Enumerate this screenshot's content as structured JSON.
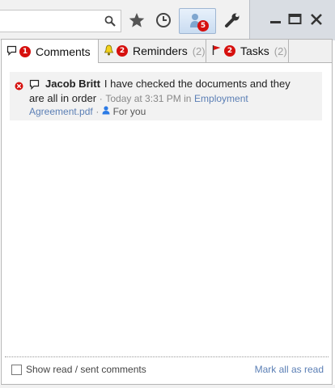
{
  "toolbar": {
    "extension_badge": "5"
  },
  "tabs": [
    {
      "label": "Comments",
      "badge": "1",
      "paren": ""
    },
    {
      "label": "Reminders",
      "badge": "2",
      "paren": "(2)"
    },
    {
      "label": "Tasks",
      "badge": "2",
      "paren": "(2)"
    }
  ],
  "comment": {
    "author": "Jacob Britt",
    "text_line1": "I have checked the documents and they",
    "text_line2": "are all in order",
    "separator": "·",
    "time": "Today at 3:31 PM in",
    "file_line1": "Employment",
    "file_line2": "Agreement.pdf",
    "for_you": "For you"
  },
  "footer": {
    "show_read_label": "Show read / sent comments",
    "mark_all_label": "Mark all as read"
  },
  "colors": {
    "badge_red": "#d6100e",
    "link_blue": "#5b7fb5"
  }
}
